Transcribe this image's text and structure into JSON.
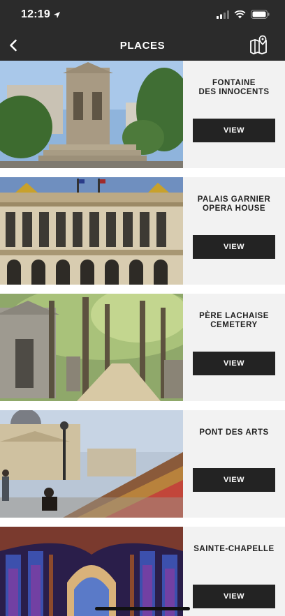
{
  "status_bar": {
    "time": "12:19",
    "icons": [
      "location-arrow-icon",
      "signal-icon",
      "wifi-icon",
      "battery-icon"
    ]
  },
  "header": {
    "title": "PLACES",
    "back_icon": "chevron-left-icon",
    "map_icon": "map-pin-icon"
  },
  "places": [
    {
      "name": "FONTAINE\nDES INNOCENTS",
      "view_label": "VIEW"
    },
    {
      "name": "PALAIS GARNIER\nOPERA HOUSE",
      "view_label": "VIEW"
    },
    {
      "name": "PÈRE LACHAISE\nCEMETERY",
      "view_label": "VIEW"
    },
    {
      "name": "PONT DES ARTS",
      "view_label": "VIEW"
    },
    {
      "name": "SAINTE-CHAPELLE",
      "view_label": "VIEW"
    }
  ],
  "colors": {
    "header_bg": "#2b2b2b",
    "card_bg": "#f2f2f2",
    "button_bg": "#232323",
    "text": "#222222"
  }
}
